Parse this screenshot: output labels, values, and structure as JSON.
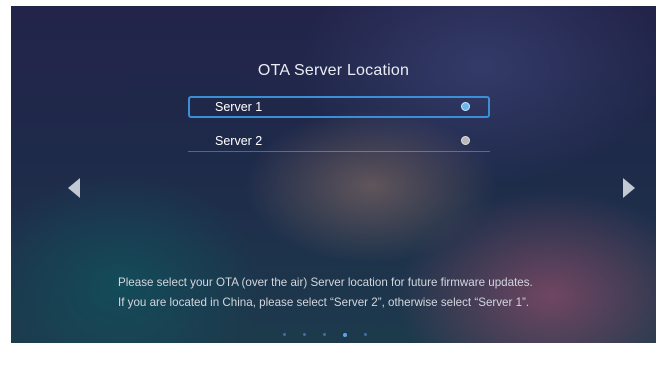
{
  "title": "OTA Server Location",
  "options": [
    {
      "label": "Server 1",
      "selected": true
    },
    {
      "label": "Server 2",
      "selected": false
    }
  ],
  "description": {
    "line1": "Please select your OTA (over the air) Server location for future firmware updates.",
    "line2": "If you are located in China, please select “Server 2”, otherwise select “Server 1”."
  },
  "navigation": {
    "left_icon": "triangle-left-icon",
    "right_icon": "triangle-right-icon"
  },
  "pagination": {
    "total": 5,
    "current": 4
  },
  "colors": {
    "focus_border": "#3b8fd6",
    "radio_selected": "#68b5f0",
    "radio_unselected": "#b8b8b8",
    "text": "#ffffff"
  }
}
